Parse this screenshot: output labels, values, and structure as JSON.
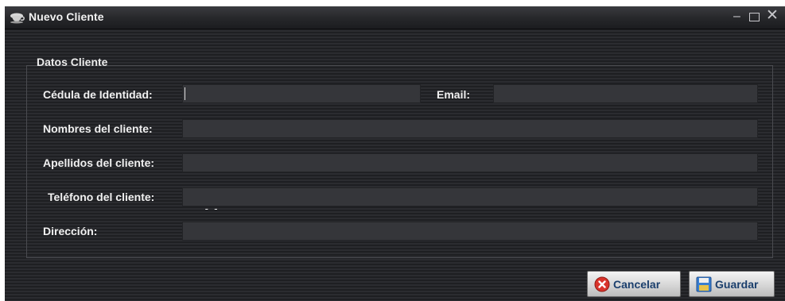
{
  "window": {
    "title": "Nuevo Cliente",
    "controls": {
      "minimize": "–",
      "maximize": "□",
      "close": "✕"
    }
  },
  "group": {
    "title": "Datos Cliente"
  },
  "fields": {
    "cedula": {
      "label": "Cédula de Identidad:",
      "value": ""
    },
    "email": {
      "label": "Email:",
      "value": ""
    },
    "nombres": {
      "label": "Nombres del cliente:",
      "value": ""
    },
    "apellidos": {
      "label": "Apellidos del cliente:",
      "value": ""
    },
    "telefono": {
      "label": "Teléfono del cliente:",
      "value": "  -  -"
    },
    "direccion": {
      "label": "Dirección:",
      "value": ""
    }
  },
  "buttons": {
    "cancel": {
      "label": "Cancelar",
      "icon": "cancel-icon"
    },
    "save": {
      "label": "Guardar",
      "icon": "floppy-disk-icon"
    }
  },
  "colors": {
    "window_bg": "#1e1f22",
    "field_bg": "#35363a",
    "text": "#f0f0f0",
    "button_text": "#1b3f6d",
    "cancel_red": "#d9342b"
  }
}
